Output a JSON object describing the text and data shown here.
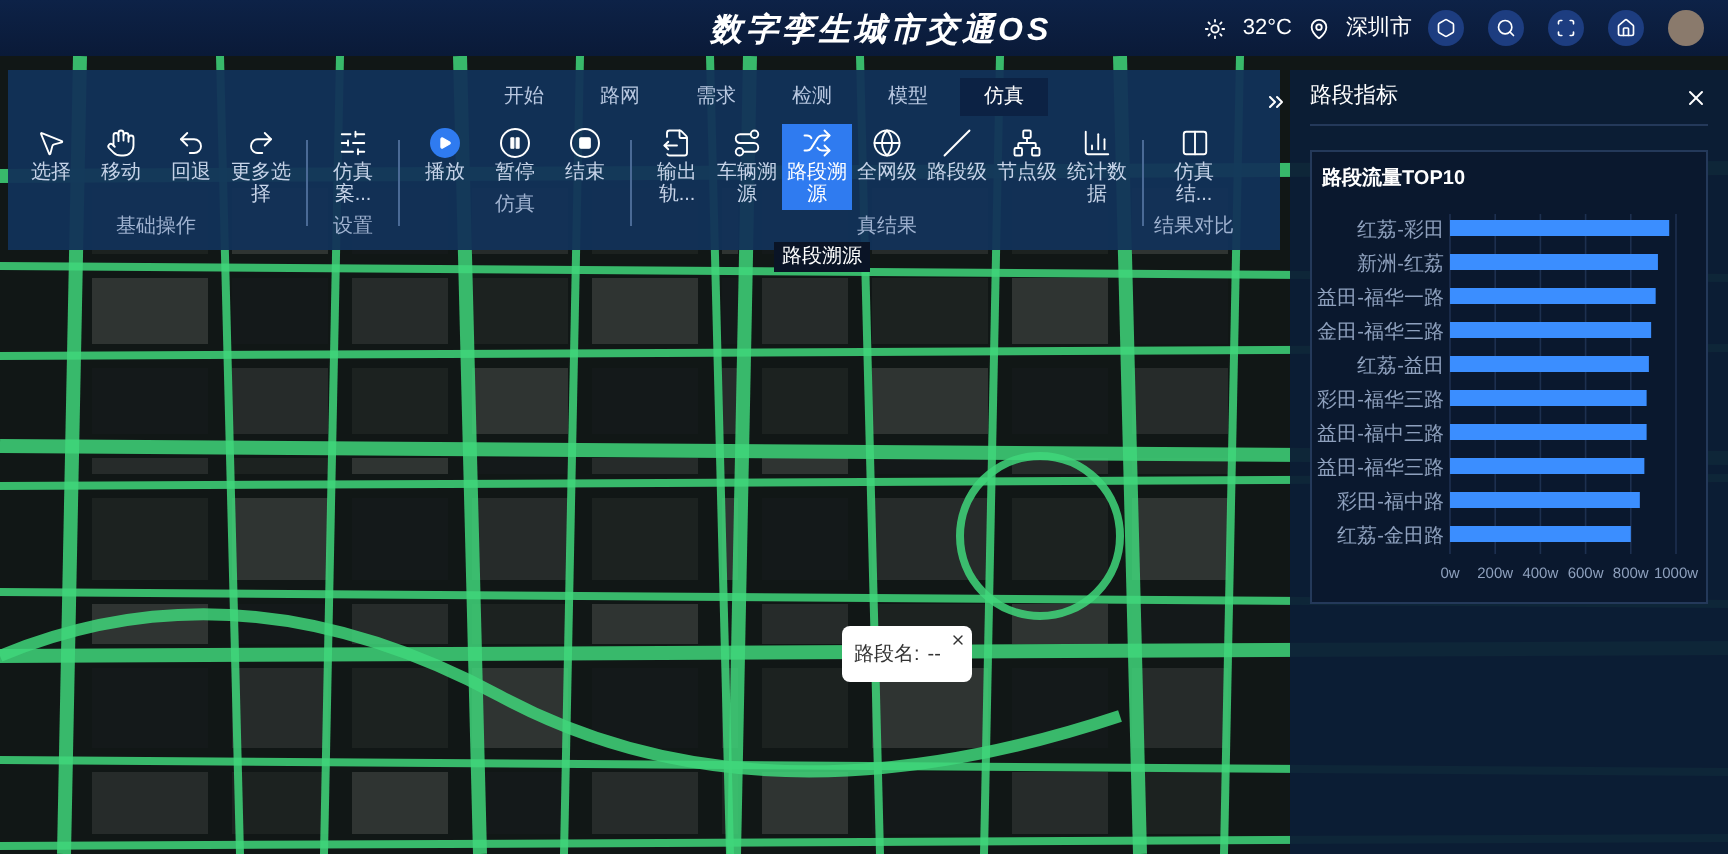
{
  "header": {
    "title": "数字孪生城市交通OS",
    "temperature": "32°C",
    "city": "深圳市"
  },
  "ribbon": {
    "tabs": [
      {
        "label": "开始",
        "selected": false
      },
      {
        "label": "路网",
        "selected": false
      },
      {
        "label": "需求",
        "selected": false
      },
      {
        "label": "检测",
        "selected": false
      },
      {
        "label": "模型",
        "selected": false
      },
      {
        "label": "仿真",
        "selected": true
      }
    ],
    "groups": [
      {
        "label": "基础操作",
        "items": [
          {
            "label": "选择",
            "selected": false
          },
          {
            "label": "移动",
            "selected": false
          },
          {
            "label": "回退",
            "selected": false
          },
          {
            "label": "更多选择",
            "selected": false
          }
        ]
      },
      {
        "label": "设置",
        "items": [
          {
            "label": "仿真案...",
            "selected": false
          }
        ]
      },
      {
        "label": "仿真",
        "items": [
          {
            "label": "播放",
            "selected": false
          },
          {
            "label": "暂停",
            "selected": false
          },
          {
            "label": "结束",
            "selected": false
          }
        ]
      },
      {
        "label": "真结果",
        "items": [
          {
            "label": "输出轨...",
            "selected": false
          },
          {
            "label": "车辆溯源",
            "selected": false
          },
          {
            "label": "路段溯源",
            "selected": true
          },
          {
            "label": "全网级",
            "selected": false
          },
          {
            "label": "路段级",
            "selected": false
          },
          {
            "label": "节点级",
            "selected": false
          },
          {
            "label": "统计数据",
            "selected": false
          }
        ]
      },
      {
        "label": "结果对比",
        "items": [
          {
            "label": "仿真结...",
            "selected": false
          }
        ]
      }
    ],
    "tooltip": "路段溯源"
  },
  "popup": {
    "label": "路段名:",
    "value": "--"
  },
  "panel": {
    "title": "路段指标",
    "chart": {
      "title": "路段流量TOP10",
      "chart_data": {
        "type": "bar",
        "orientation": "horizontal",
        "categories": [
          "红荔-彩田",
          "新洲-红荔",
          "益田-福华一路",
          "金田-福华三路",
          "红荔-益田",
          "彩田-福华三路",
          "益田-福中三路",
          "益田-福华三路",
          "彩田-福中路",
          "红荔-金田路"
        ],
        "series": [
          {
            "color": "#3b8eff",
            "values": [
              970,
              920,
              910,
              890,
              880,
              870,
              870,
              860,
              840,
              800
            ]
          }
        ],
        "grid": true,
        "xlim": [
          0,
          1000
        ],
        "xticks": [
          {
            "value": 0,
            "label": "0w"
          },
          {
            "value": 200,
            "label": "200w"
          },
          {
            "value": 400,
            "label": "400w"
          },
          {
            "value": 600,
            "label": "600w"
          },
          {
            "value": 800,
            "label": "800w"
          },
          {
            "value": 1000,
            "label": "1000w"
          }
        ]
      }
    }
  }
}
